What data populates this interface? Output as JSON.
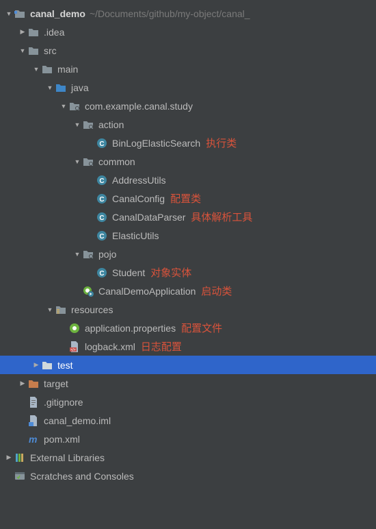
{
  "root": {
    "name": "canal_demo",
    "path": "~/Documents/github/my-object/canal_"
  },
  "tree": {
    "idea": ".idea",
    "src": "src",
    "main": "main",
    "java": "java",
    "package": "com.example.canal.study",
    "action": "action",
    "binLogElasticSearch": "BinLogElasticSearch",
    "binLogElasticSearch_note": "执行类",
    "common": "common",
    "addressUtils": "AddressUtils",
    "canalConfig": "CanalConfig",
    "canalConfig_note": "配置类",
    "canalDataParser": "CanalDataParser",
    "canalDataParser_note": "具体解析工具",
    "elasticUtils": "ElasticUtils",
    "pojo": "pojo",
    "student": "Student",
    "student_note": "对象实体",
    "canalDemoApplication": "CanalDemoApplication",
    "canalDemoApplication_note": "启动类",
    "resources": "resources",
    "appProps": "application.properties",
    "appProps_note": "配置文件",
    "logback": "logback.xml",
    "logback_note": "日志配置",
    "test": "test",
    "target": "target",
    "gitignore": ".gitignore",
    "iml": "canal_demo.iml",
    "pom": "pom.xml"
  },
  "external": "External Libraries",
  "scratches": "Scratches and Consoles",
  "icons": {
    "arrow_down": "▼",
    "arrow_right": "▶"
  }
}
